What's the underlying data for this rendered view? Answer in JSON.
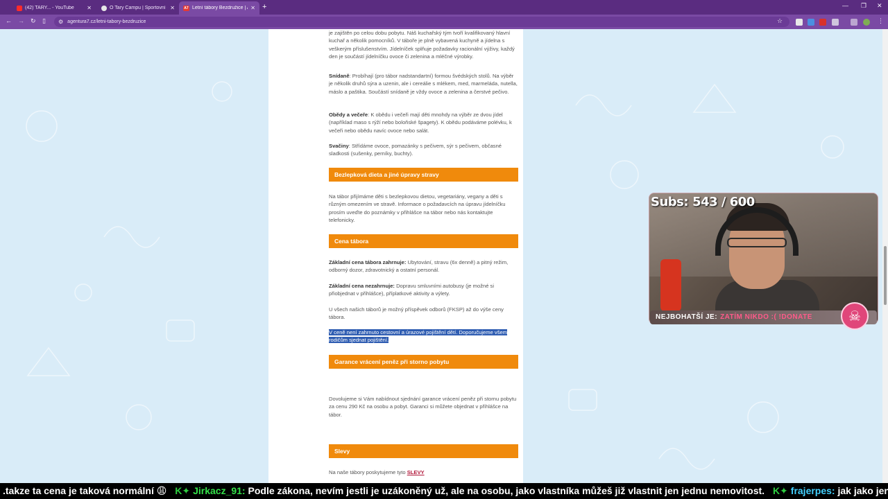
{
  "browser": {
    "tabs": [
      {
        "title": "(42) TARY... - YouTube"
      },
      {
        "title": "O Tary Campu | Sportovní camp..."
      },
      {
        "title": "Letní tábory Bezdružice | Agen..."
      }
    ],
    "url": "agentura7.cz/letni-tabory-bezdruzice"
  },
  "page": {
    "intro": "je zajištěn po celou dobu pobytu. Náš kuchařský tým tvoří kvalifikovaný hlavní kuchař a několik pomocníků. V táboře je plně vybavená kuchyně a jídelna s veškerým příslušenstvím. Jídelníček splňuje požadavky racionální výživy, každý den je součástí jídelníčku ovoce či zelenina a mléčné výrobky.",
    "breakfast_label": "Snídaně",
    "breakfast_text": ": Probíhají (pro tábor nadstandartní) formou švédských stolů. Na výběr je několik druhů sýra a uzenin, ale i cereálie s mlékem, med, marmeláda, nutella, máslo a paštika. Součástí snídaně je vždy ovoce a zelenina a čerstvé pečivo.",
    "lunch_label": "Obědy a večeře",
    "lunch_text": ": K obědu i večeři mají děti mnohdy na výběr ze dvou jídel (například maso s rýží nebo boloňské špagety). K obědu podáváme polévku, k večeři nebo obědu navíc ovoce nebo salát.",
    "snack_label": "Svačiny",
    "snack_text": ": Střídáme ovoce, pomazánky s pečivem, sýr s pečivem, občasné sladkosti (sušenky, perníky, buchty).",
    "heading_gluten": "Bezlepková dieta a jiné úpravy stravy",
    "gluten_text": "Na tábor přijímáme děti s bezlepkovou dietou, vegetariány, vegany a děti s různým omezením ve stravě. Informace o požadavcích na úpravu jídelníčku prosím uveďte do poznámky v přihlášce na tábor nebo nás kontaktujte telefonicky.",
    "heading_price": "Cena tábora",
    "price_incl_label": "Základní cena tábora zahrnuje:",
    "price_incl_text": " Ubytování, stravu (6x denně) a pitný režim, odborný dozor, zdravotnický a ostatní personál.",
    "price_excl_label": "Základní cena nezahrnuje:",
    "price_excl_text": " Dopravu smluvními autobusy (je možné si přiobjednat v přihlášce), příplatkové aktivity a výlety.",
    "fksp_text": "U všech našich táborů je možný příspěvek odborů (FKSP) až do výše ceny tábora.",
    "insurance_text_1": "V ceně není zahrnuto cestovní a úrazové pojištění dětí. Doporučujeme všem",
    "insurance_text_2": "rodičům sjednat pojištění.",
    "heading_refund": "Garance vrácení peněz při storno pobytu",
    "refund_text": "Dovolujeme si Vám nabídnout sjednání garance vrácení peněz při stornu pobytu za cenu 290 Kč na osobu a pobyt. Garanci si můžete objednat v přihlášce na tábor.",
    "heading_discounts": "Slevy",
    "discounts_text": "Na naše tábory poskytujeme tyto ",
    "discounts_link": "SLEVY"
  },
  "overlay": {
    "subs_label": "Subs:",
    "subs_value": "543 / 600",
    "richest_label": "NEJBOHATŠÍ JE:",
    "richest_value": "ZATÍM NIKDO :( !DONATE"
  },
  "chat": {
    "m1": ".takze ta cena je taková normální 😩",
    "u1": "Jirkacz_91:",
    "m2": " Podle zákona, nevím jestli je uzákoněný už, ale na osobu, jako vlastníka můžeš již vlastnit jen jednu nemovitost.",
    "u2": "frajerpes:",
    "m3": " jak jako jen jednu nemovitost"
  },
  "colors": {
    "accent": "#f08a0c",
    "tab_bar": "#5a2c80",
    "highlight": "#2f5db2"
  }
}
